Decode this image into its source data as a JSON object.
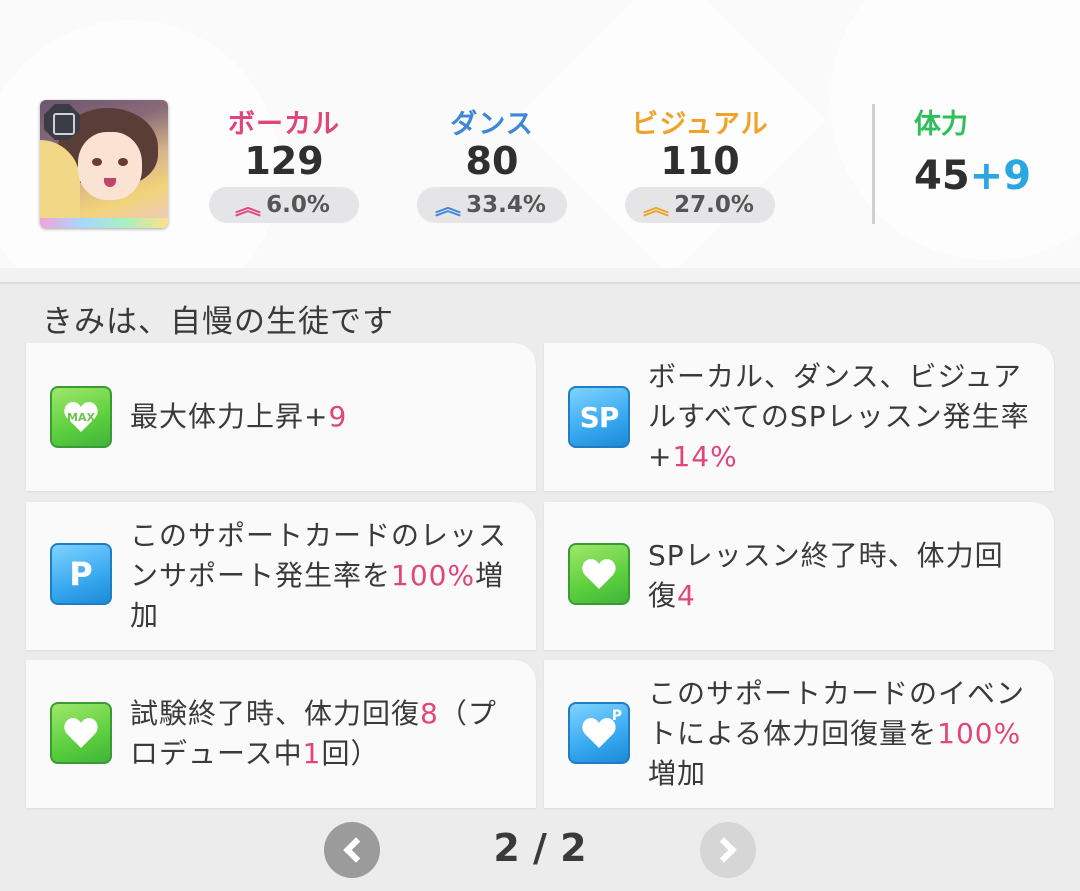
{
  "stats": {
    "vocal": {
      "label": "ボーカル",
      "value": "129",
      "bonus": "6.0%"
    },
    "dance": {
      "label": "ダンス",
      "value": "80",
      "bonus": "33.4%"
    },
    "visual": {
      "label": "ビジュアル",
      "value": "110",
      "bonus": "27.0%"
    },
    "stamina": {
      "label": "体力",
      "value": "45",
      "bonus": "+9"
    }
  },
  "section_title": "きみは、自慢の生徒です",
  "effects": [
    {
      "icon": "max-stamina-icon",
      "pre": "最大体力上昇+",
      "hl": "9",
      "post": ""
    },
    {
      "icon": "sp-icon",
      "pre": "ボーカル、ダンス、ビジュアルすべてのSPレッスン発生率+",
      "hl": "14%",
      "post": ""
    },
    {
      "icon": "p-support-icon",
      "pre": "このサポートカードのレッスンサポート発生率を",
      "hl": "100%",
      "post": "増加"
    },
    {
      "icon": "heart-icon",
      "pre": "SPレッスン終了時、体力回復",
      "hl": "4",
      "post": ""
    },
    {
      "icon": "heart-icon",
      "pre": "試験終了時、体力回復",
      "hl": "8",
      "mid": "（プロデュース中",
      "hl2": "1",
      "post": "回）"
    },
    {
      "icon": "p-heart-icon",
      "pre": "このサポートカードのイベントによる体力回復量を",
      "hl": "100%",
      "post": "増加"
    }
  ],
  "pager": {
    "text": "2 / 2"
  },
  "colors": {
    "vocal": "#e0457b",
    "dance": "#3d86d8",
    "visual": "#f0a32a",
    "stamina": "#2fbf5a",
    "highlight": "#e0457b"
  }
}
